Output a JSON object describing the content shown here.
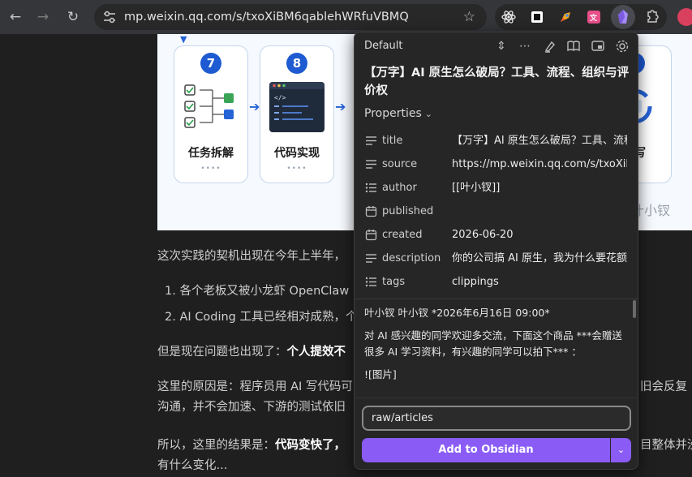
{
  "browser": {
    "url": "mp.weixin.qq.com/s/txoXiBM6qablehWRfuVBMQ",
    "back_icon": "←",
    "forward_icon": "→",
    "reload_icon": "↻",
    "star_icon": "☆",
    "colors": {
      "toolbar": "#35363a",
      "omnibox": "#282828"
    }
  },
  "article": {
    "figure": {
      "steps": [
        {
          "num": "7",
          "title": "任务拆解",
          "dots": "••••"
        },
        {
          "num": "8",
          "title": "代码实现",
          "dots": "••••"
        },
        {
          "num": "2",
          "title": "回写",
          "dots": ""
        }
      ],
      "watermark": "叶小钗"
    },
    "p1": "这次实践的契机出现在今年上半年，",
    "list": [
      "1. 各个老板又被小龙虾 OpenClaw",
      "2. AI Coding 工具已经相对成熟，个"
    ],
    "p2_a": "但是现在问题也出现了：",
    "p2_b": "个人提效不",
    "p3_l1": "这里的原因是：程序员用 AI 写代码可",
    "p3_r1": "旧会反复",
    "p3_l2": "沟通，并不会加速、下游的测试依旧",
    "p4_a": "所以，这里的结果是：",
    "p4_b": "代码变快了，",
    "p4_r": "目整体并没",
    "p4_l2": "有什么变化..."
  },
  "clipper": {
    "template": "Default",
    "title": "【万字】AI 原生怎么破局？工具、流程、组织与评价权",
    "properties_label": "Properties",
    "properties": [
      {
        "key": "title",
        "value": "【万字】AI 原生怎么破局？工具、流程、组织与评价权",
        "icon": "text-lines-icon"
      },
      {
        "key": "source",
        "value": "https://mp.weixin.qq.com/s/txoXiBM6qablehWRfuVBMQ",
        "icon": "text-lines-icon"
      },
      {
        "key": "author",
        "value": "[[叶小钗]]",
        "icon": "list-icon"
      },
      {
        "key": "published",
        "value": "",
        "icon": "calendar-icon"
      },
      {
        "key": "created",
        "value": "2026-06-20",
        "icon": "calendar-icon"
      },
      {
        "key": "description",
        "value": "你的公司搞 AI 原生，我为什么要花额",
        "icon": "text-lines-icon"
      },
      {
        "key": "tags",
        "value": "clippings",
        "icon": "list-icon"
      }
    ],
    "content_lines": [
      "叶小钗 叶小钗 *2026年6月16日 09:00*",
      "对 AI 感兴趣的同学欢迎多交流，下面这个商品 ***会赠送很多 AI 学习资料，有兴趣的同学可以拍下*** ：",
      "![图片]"
    ],
    "path_value": "raw/articles",
    "add_button": "Add to Obsidian",
    "accent": "#8a5cf5"
  }
}
